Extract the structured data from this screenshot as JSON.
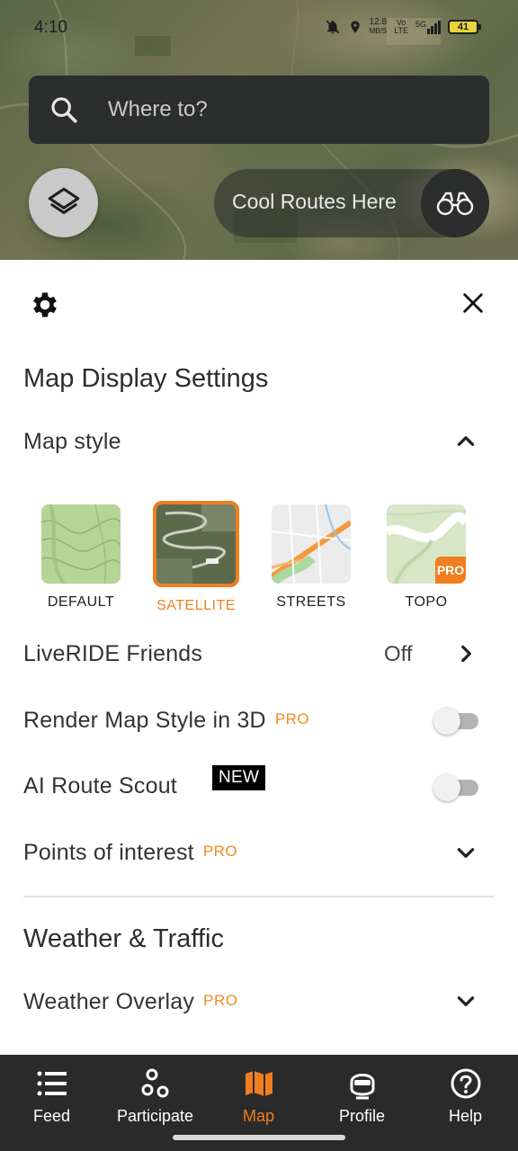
{
  "status_bar": {
    "time": "4:10",
    "speed_value": "12.8",
    "speed_unit": "MB/S",
    "network_top": "Vo",
    "network_bottom": "LTE",
    "signal_label": "5G",
    "battery": "41"
  },
  "map": {
    "search_placeholder": "Where to?",
    "cool_routes_label": "Cool Routes Here"
  },
  "settings": {
    "title": "Map Display Settings",
    "map_style_label": "Map style",
    "styles": [
      {
        "name": "DEFAULT",
        "selected": false
      },
      {
        "name": "SATELLITE",
        "selected": true
      },
      {
        "name": "STREETS",
        "selected": false
      },
      {
        "name": "TOPO",
        "selected": false,
        "badge": "PRO"
      }
    ],
    "liveride_label": "LiveRIDE Friends",
    "liveride_value": "Off",
    "render_3d_label": "Render Map Style in 3D",
    "render_3d_badge": "PRO",
    "render_3d_enabled": false,
    "ai_scout_label": "AI Route Scout",
    "ai_scout_badge": "NEW",
    "ai_scout_enabled": false,
    "poi_label": "Points of interest",
    "poi_badge": "PRO",
    "weather_title": "Weather & Traffic",
    "weather_overlay_label": "Weather Overlay",
    "weather_overlay_badge": "PRO"
  },
  "bottom_nav": {
    "items": [
      {
        "label": "Feed",
        "icon": "list-icon",
        "active": false
      },
      {
        "label": "Participate",
        "icon": "participate-icon",
        "active": false
      },
      {
        "label": "Map",
        "icon": "map-icon",
        "active": true
      },
      {
        "label": "Profile",
        "icon": "profile-icon",
        "active": false
      },
      {
        "label": "Help",
        "icon": "help-icon",
        "active": false
      }
    ]
  },
  "colors": {
    "accent": "#f07e1e",
    "nav_bg": "#2a2a2a",
    "search_bg": "#2c2d2d"
  }
}
